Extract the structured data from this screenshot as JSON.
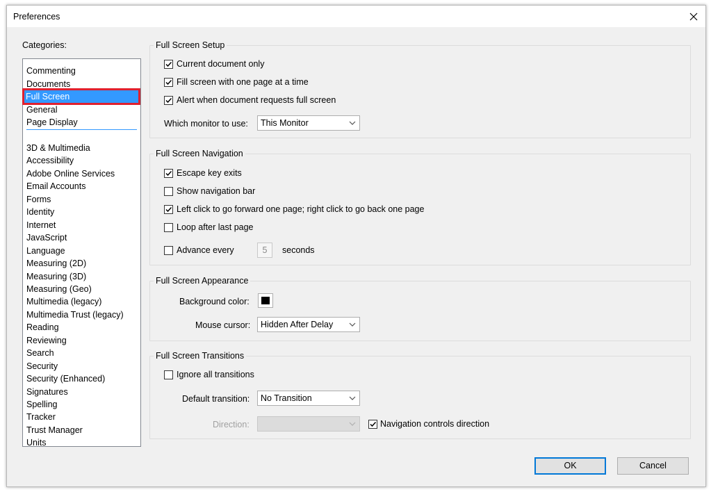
{
  "window": {
    "title": "Preferences"
  },
  "categories": {
    "label": "Categories:",
    "top": [
      "Commenting",
      "Documents",
      "Full Screen",
      "General",
      "Page Display"
    ],
    "selected": "Full Screen",
    "bottom": [
      "3D & Multimedia",
      "Accessibility",
      "Adobe Online Services",
      "Email Accounts",
      "Forms",
      "Identity",
      "Internet",
      "JavaScript",
      "Language",
      "Measuring (2D)",
      "Measuring (3D)",
      "Measuring (Geo)",
      "Multimedia (legacy)",
      "Multimedia Trust (legacy)",
      "Reading",
      "Reviewing",
      "Search",
      "Security",
      "Security (Enhanced)",
      "Signatures",
      "Spelling",
      "Tracker",
      "Trust Manager",
      "Units"
    ]
  },
  "setup": {
    "title": "Full Screen Setup",
    "current_doc": {
      "label": "Current document only",
      "checked": true
    },
    "fill_screen": {
      "label": "Fill screen with one page at a time",
      "checked": true
    },
    "alert": {
      "label": "Alert when document requests full screen",
      "checked": true
    },
    "monitor_label": "Which monitor to use:",
    "monitor_value": "This Monitor"
  },
  "navigation": {
    "title": "Full Screen Navigation",
    "escape": {
      "label": "Escape key exits",
      "checked": true
    },
    "nav_bar": {
      "label": "Show navigation bar",
      "checked": false
    },
    "left_click": {
      "label": "Left click to go forward one page; right click to go back one page",
      "checked": true
    },
    "loop": {
      "label": "Loop after last page",
      "checked": false
    },
    "advance": {
      "label": "Advance every",
      "checked": false
    },
    "advance_value": "5",
    "seconds_label": "seconds"
  },
  "appearance": {
    "title": "Full Screen Appearance",
    "bg_label": "Background color:",
    "bg_color": "#000000",
    "cursor_label": "Mouse cursor:",
    "cursor_value": "Hidden After Delay"
  },
  "transitions": {
    "title": "Full Screen Transitions",
    "ignore": {
      "label": "Ignore all transitions",
      "checked": false
    },
    "default_label": "Default transition:",
    "default_value": "No Transition",
    "direction_label": "Direction:",
    "direction_value": "",
    "nav_controls": {
      "label": "Navigation controls direction",
      "checked": true
    }
  },
  "buttons": {
    "ok": "OK",
    "cancel": "Cancel"
  },
  "colors": {
    "selection": "#3399ff",
    "highlight_box": "#e0202e",
    "default_button_border": "#0078d7"
  }
}
